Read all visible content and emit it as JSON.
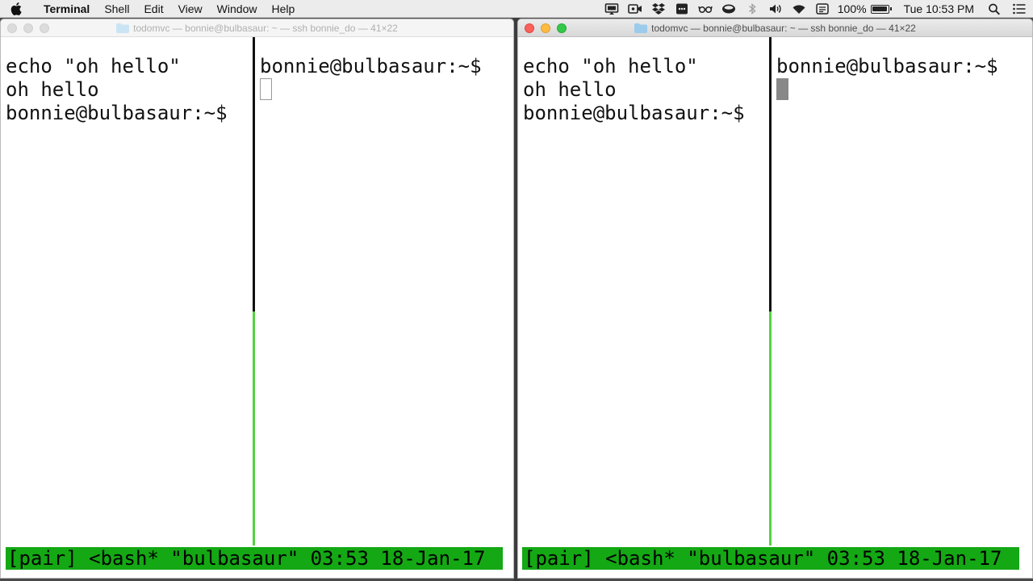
{
  "menubar": {
    "app_name": "Terminal",
    "items": [
      "Shell",
      "Edit",
      "View",
      "Window",
      "Help"
    ],
    "battery_percent": "100%",
    "clock": "Tue 10:53 PM",
    "icons": [
      "apple-icon",
      "screen-mirror-icon",
      "video-camera-icon",
      "dropbox-icon",
      "messages-icon",
      "glasses-icon",
      "bowl-icon",
      "bluetooth-icon",
      "volume-icon",
      "wifi-icon",
      "keyboard-input-icon",
      "battery-icon",
      "spotlight-search-icon",
      "notification-center-icon"
    ]
  },
  "windows": [
    {
      "title": "todomvc — bonnie@bulbasaur: ~ — ssh bonnie_do — 41×22",
      "active": false,
      "left_pane": [
        "echo \"oh hello\"",
        "oh hello",
        "bonnie@bulbasaur:~$"
      ],
      "right_pane_prompt": "bonnie@bulbasaur:~$",
      "status_line": "[pair] <bash* \"bulbasaur\" 03:53 18-Jan-17"
    },
    {
      "title": "todomvc — bonnie@bulbasaur: ~ — ssh bonnie_do — 41×22",
      "active": true,
      "left_pane": [
        "echo \"oh hello\"",
        "oh hello",
        "bonnie@bulbasaur:~$"
      ],
      "right_pane_prompt": "bonnie@bulbasaur:~$",
      "status_line": "[pair] <bash* \"bulbasaur\" 03:53 18-Jan-17"
    }
  ],
  "colors": {
    "tmux_status": "#14a814",
    "active_divider": "#55d33f",
    "close": "#fc605b",
    "minimize": "#fdbc40",
    "maximize": "#34c84a"
  }
}
